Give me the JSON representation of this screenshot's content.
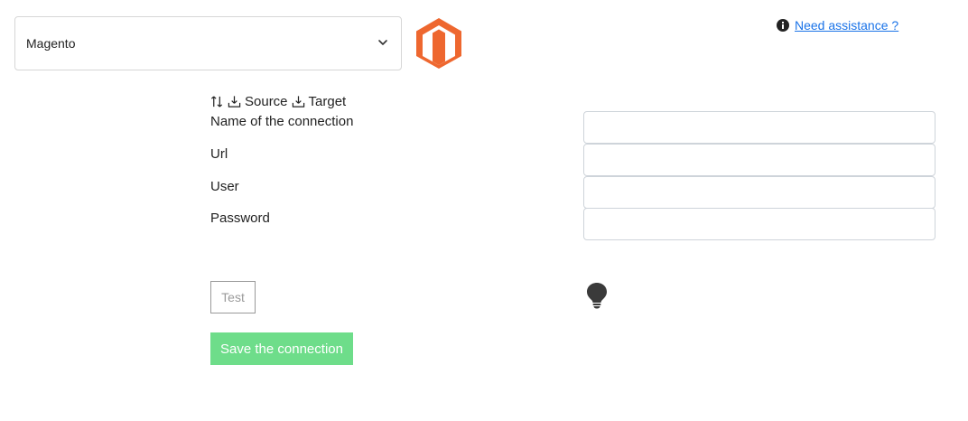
{
  "connector": {
    "selected": "Magento",
    "logo_icon": "magento-logo-icon",
    "logo_color": "#ee672f"
  },
  "help": {
    "icon": "info-circle-icon",
    "link_text": "Need assistance ?"
  },
  "direction": {
    "icon": "swap-vertical-icon",
    "source_label": "Source",
    "target_label": "Target"
  },
  "form": {
    "connection_name_label": "Name of the connection",
    "url_label": "Url",
    "user_label": "User",
    "password_label": "Password",
    "connection_name_value": "",
    "url_value": "",
    "user_value": "",
    "password_value": ""
  },
  "actions": {
    "test_label": "Test",
    "save_label": "Save the connection",
    "status_icon": "lightbulb-icon",
    "save_color": "#6edd8a"
  }
}
